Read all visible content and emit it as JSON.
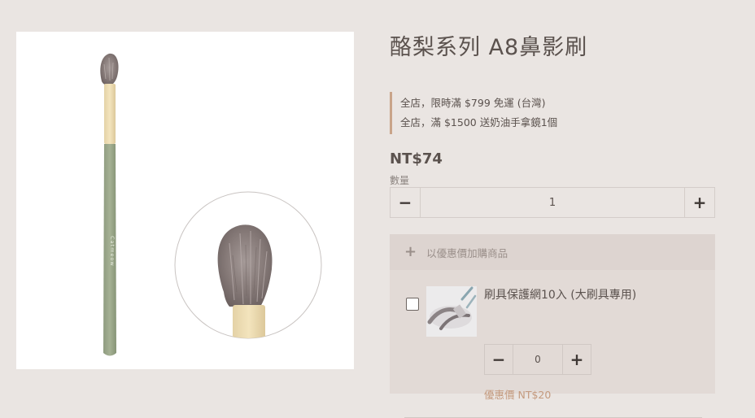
{
  "product": {
    "title": "酪梨系列 A8鼻影刷",
    "promotions": [
      "全店，限時滿 $799 免運 (台灣)",
      "全店，滿 $1500 送奶油手拿鏡1個"
    ],
    "price": "NT$74",
    "quantity_label": "數量",
    "quantity_value": "1",
    "image_icon": "makeup-brush-photo",
    "brush_handle_text": "Catmeow"
  },
  "addon": {
    "header_label": "以優惠價加購商品",
    "header_icon": "plus-icon",
    "item": {
      "name": "刷具保護網10入 (大刷具專用)",
      "quantity_value": "0",
      "price": "優惠價 NT$20",
      "checked": false
    }
  },
  "colors": {
    "background": "#eae5e2",
    "accent": "#c9a489",
    "addon_bg": "#e2dad6",
    "discount_price": "#c49a7e"
  }
}
